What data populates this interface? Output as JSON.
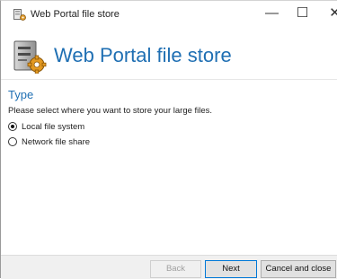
{
  "window": {
    "title": "Web Portal file store",
    "minimize_glyph": "—",
    "maximize_glyph": "☐",
    "close_glyph": "✕"
  },
  "header": {
    "title": "Web Portal file store",
    "icon": "file-store-gear-icon"
  },
  "section": {
    "heading": "Type",
    "instruction": "Please select where you want to store your large files."
  },
  "options": [
    {
      "label": "Local file system",
      "selected": true
    },
    {
      "label": "Network file share",
      "selected": false
    }
  ],
  "footer": {
    "back_label": "Back",
    "next_label": "Next",
    "cancel_label": "Cancel and close"
  },
  "colors": {
    "accent": "#1f6fb3",
    "focus_border": "#0078d7"
  }
}
